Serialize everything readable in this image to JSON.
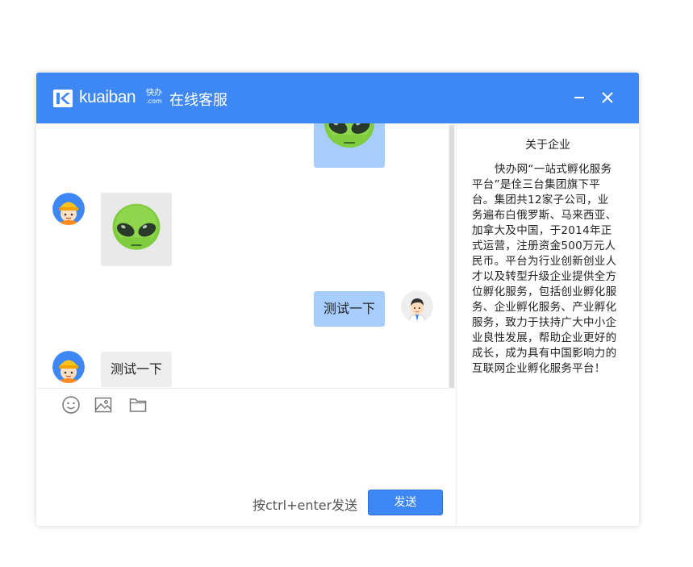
{
  "window": {
    "brand": "kuaiban",
    "brand_cn": "快办",
    "brand_domain": ".com",
    "title": "在线客服"
  },
  "chat": {
    "messages": [
      {
        "from": "me",
        "type": "image",
        "content": "alien-emoji"
      },
      {
        "from": "agent",
        "type": "image",
        "content": "alien-emoji"
      },
      {
        "from": "me",
        "type": "text",
        "content": "测试一下"
      },
      {
        "from": "agent",
        "type": "text",
        "content": "测试一下"
      }
    ]
  },
  "toolbar": {
    "icons": [
      "smiley-icon",
      "image-icon",
      "folder-icon"
    ]
  },
  "composer": {
    "hint": "按ctrl+enter发送",
    "send_label": "发送",
    "value": ""
  },
  "about": {
    "title": "关于企业",
    "body": "快办网“一站式孵化服务平台”是佺三台集团旗下平台。集团共12家子公司，业务遍布白俄罗斯、马来西亚、加拿大及中国，于2014年正式运营，注册资金500万元人民币。平台为行业创新创业人才以及转型升级企业提供全方位孵化服务，包括创业孵化服务、企业孵化服务、产业孵化服务，致力于扶持广大中小企业良性发展，帮助企业更好的成长，成为具有中国影响力的互联网企业孵化服务平台！"
  },
  "colors": {
    "titlebar": "#3d88f5",
    "my_bubble": "#a7cdfc",
    "agent_bubble": "#eeeeee",
    "send_button": "#3d88f5"
  }
}
